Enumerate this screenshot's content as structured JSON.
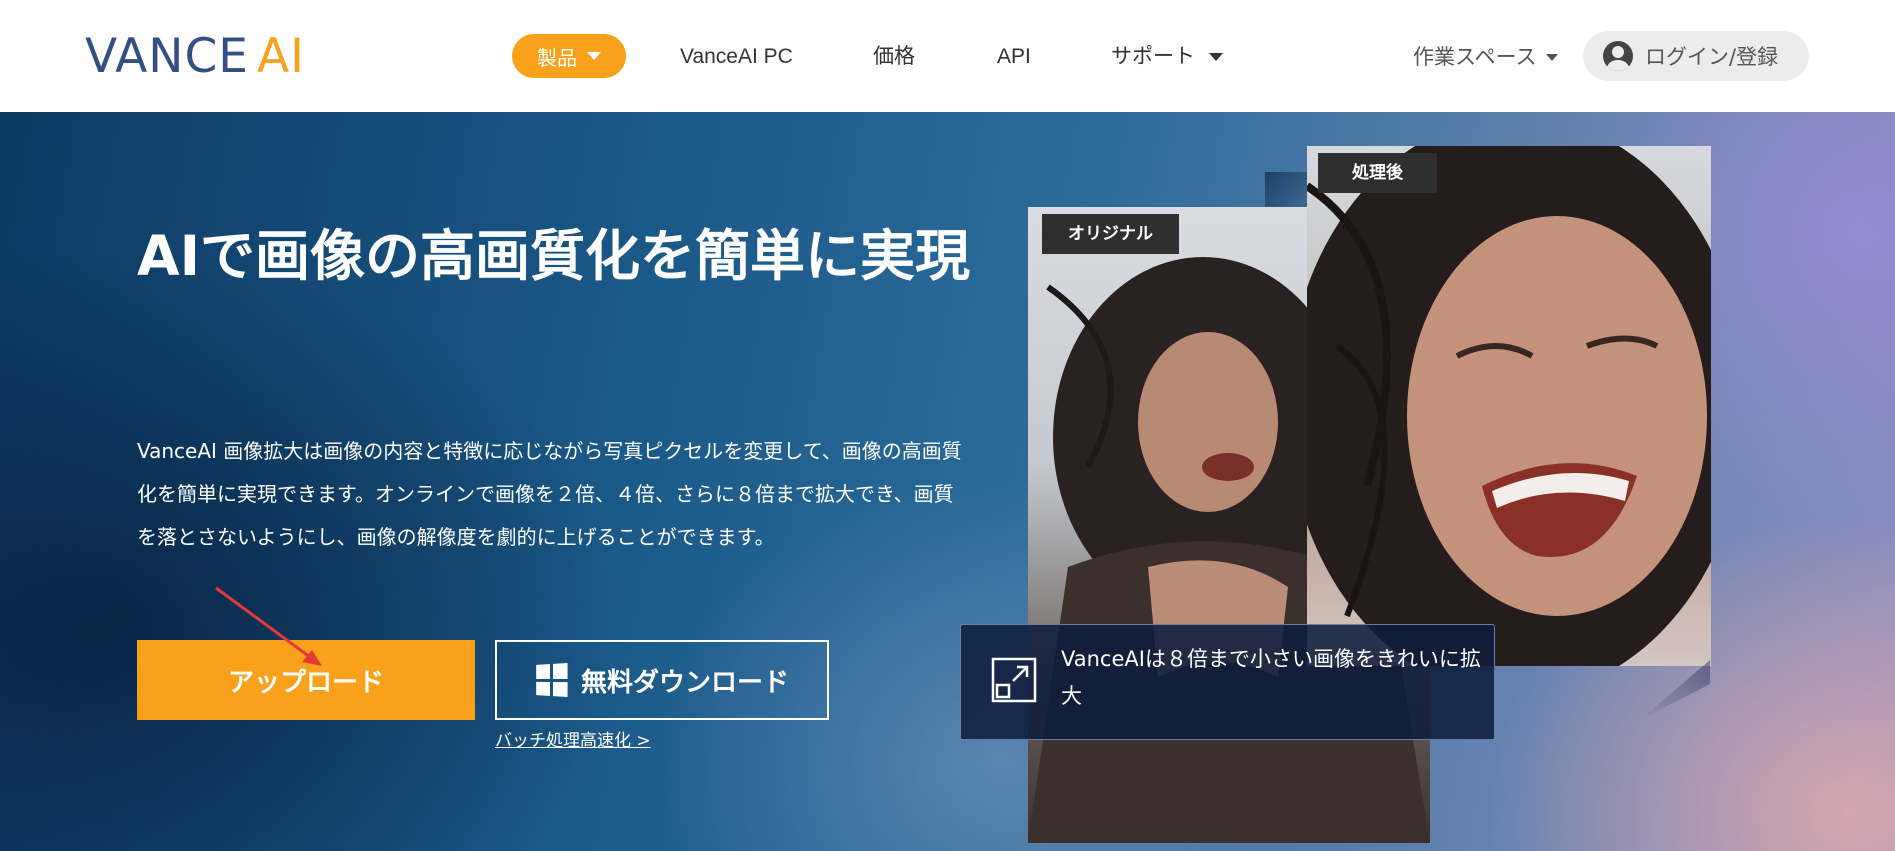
{
  "header": {
    "logo_main": "VANCE",
    "logo_accent": "AI",
    "nav": {
      "products": "製品",
      "pc": "VanceAI PC",
      "pricing": "価格",
      "api": "API",
      "support": "サポート"
    },
    "workspace": "作業スペース",
    "login": "ログイン/登録"
  },
  "hero": {
    "title": "AIで画像の高画質化を簡単に実現",
    "description": "VanceAI 画像拡大は画像の内容と特徴に応じながら写真ピクセルを変更して、画像の高画質化を簡単に実現できます。オンラインで画像を２倍、４倍、さらに８倍まで拡大でき、画質を落とさないようにし、画像の解像度を劇的に上げることができます。",
    "upload_button": "アップロード",
    "download_button": "無料ダウンロード",
    "batch_link": "バッチ処理高速化 >",
    "tag_original": "オリジナル",
    "tag_after": "処理後",
    "info_text": "VanceAIは８倍まで小さい画像をきれいに拡大"
  },
  "colors": {
    "accent": "#f9a11b",
    "logo_blue": "#344f86",
    "hero_dark": "#0d3a63"
  }
}
